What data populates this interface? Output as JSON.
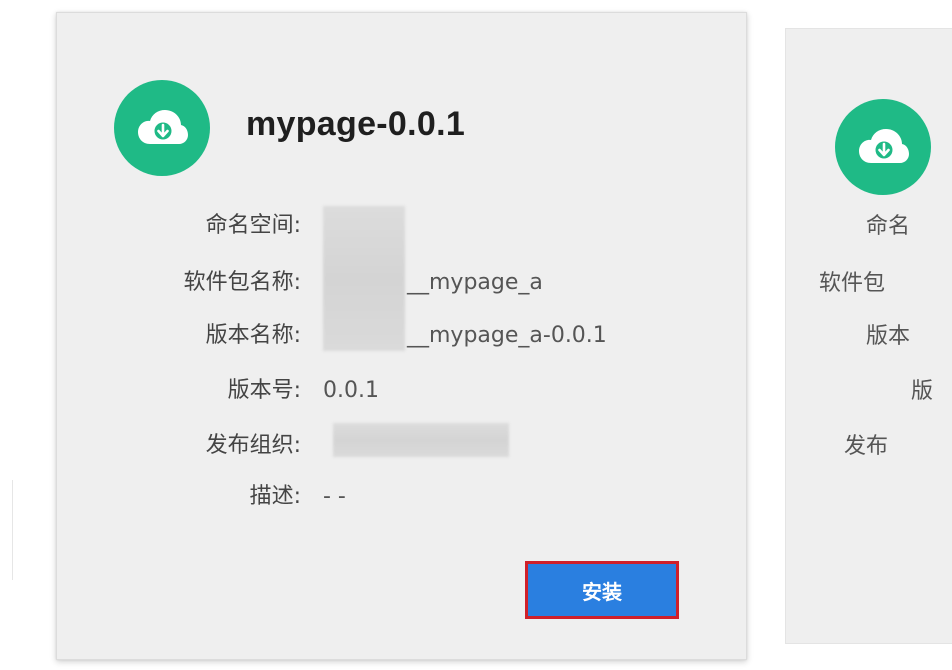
{
  "main_card": {
    "title": "mypage-0.0.1",
    "icon": "cloud-download-icon",
    "fields": [
      {
        "label": "命名空间:",
        "value": ""
      },
      {
        "label": "软件包名称:",
        "value": "__mypage_a"
      },
      {
        "label": "版本名称:",
        "value": "__mypage_a-0.0.1"
      },
      {
        "label": "版本号:",
        "value": "0.0.1"
      },
      {
        "label": "发布组织:",
        "value": ""
      },
      {
        "label": "描述:",
        "value": "- -"
      }
    ],
    "install_label": "安装"
  },
  "second_card": {
    "icon": "cloud-download-icon",
    "labels": [
      "命名",
      "软件包",
      "版本",
      "版",
      "发布"
    ]
  },
  "colors": {
    "icon_bg": "#1fba86",
    "button_bg": "#2a7fe0",
    "button_highlight_border": "#d0202a",
    "card_bg": "#efefef"
  }
}
